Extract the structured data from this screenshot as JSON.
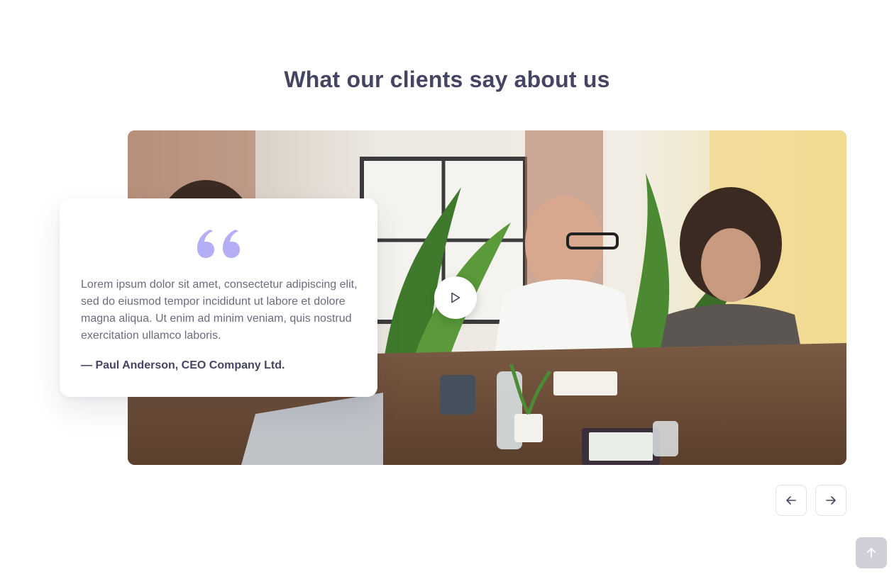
{
  "section": {
    "title": "What our clients say about us"
  },
  "testimonial": {
    "quote": "Lorem ipsum dolor sit amet, consectetur adipiscing elit, sed do eiusmod tempor incididunt ut labore et dolore magna aliqua. Ut enim ad minim veniam, quis nostrud exercitation ullamco laboris.",
    "author": "— Paul Anderson, CEO Company Ltd.",
    "quote_icon": "quote-mark-icon"
  },
  "media": {
    "image": "team-meeting-photo",
    "play_icon": "play-icon"
  },
  "carousel": {
    "prev_icon": "arrow-left-icon",
    "next_icon": "arrow-right-icon"
  },
  "scroll_top": {
    "icon": "arrow-up-icon"
  },
  "colors": {
    "heading": "#454563",
    "body_text": "#6b6b80",
    "accent": "#b3aef5",
    "scroll_top_bg": "#cfcfda"
  }
}
